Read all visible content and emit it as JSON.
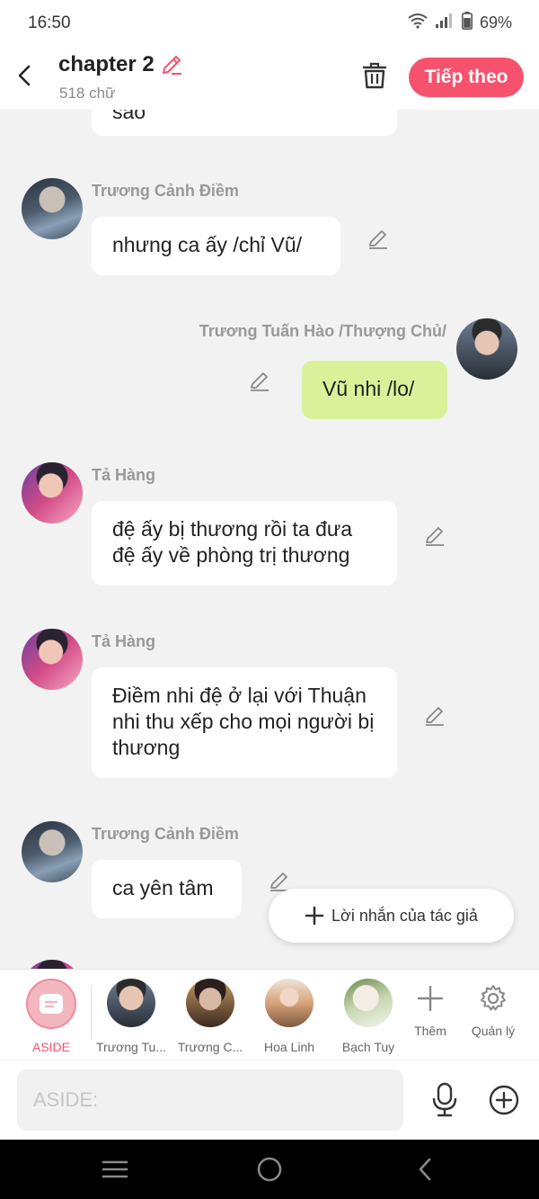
{
  "status": {
    "time": "16:50",
    "battery": "69%"
  },
  "header": {
    "title": "chapter 2",
    "word_count": "518 chữ",
    "next_label": "Tiếp theo"
  },
  "messages": [
    {
      "text": "sao"
    },
    {
      "author": "Trương Cảnh Điềm",
      "text": "nhưng ca ấy /chỉ Vũ/"
    },
    {
      "author": "Trương Tuấn Hào /Thượng Chủ/",
      "text": "Vũ nhi /lo/"
    },
    {
      "author": "Tả Hàng",
      "text": "đệ ấy bị thương rồi ta đưa đệ ấy về phòng trị thương"
    },
    {
      "author": "Tả Hàng",
      "text": "Điềm nhi đệ ở lại với Thuận nhi thu xếp cho mọi người bị thương"
    },
    {
      "author": "Trương Cảnh Điềm",
      "text": "ca yên tâm"
    }
  ],
  "fab": {
    "label": "Lời nhắn của tác giả"
  },
  "characters": [
    {
      "label": "ASIDE"
    },
    {
      "label": "Trương Tu..."
    },
    {
      "label": "Trương C..."
    },
    {
      "label": "Hoa Linh"
    },
    {
      "label": "Bạch Tuy"
    }
  ],
  "tools": {
    "add": "Thêm",
    "manage": "Quản lý"
  },
  "input": {
    "placeholder": "ASIDE:"
  },
  "colors": {
    "accent": "#f6526e",
    "my_bubble": "#d9f29a",
    "background": "#f2f2f2"
  }
}
